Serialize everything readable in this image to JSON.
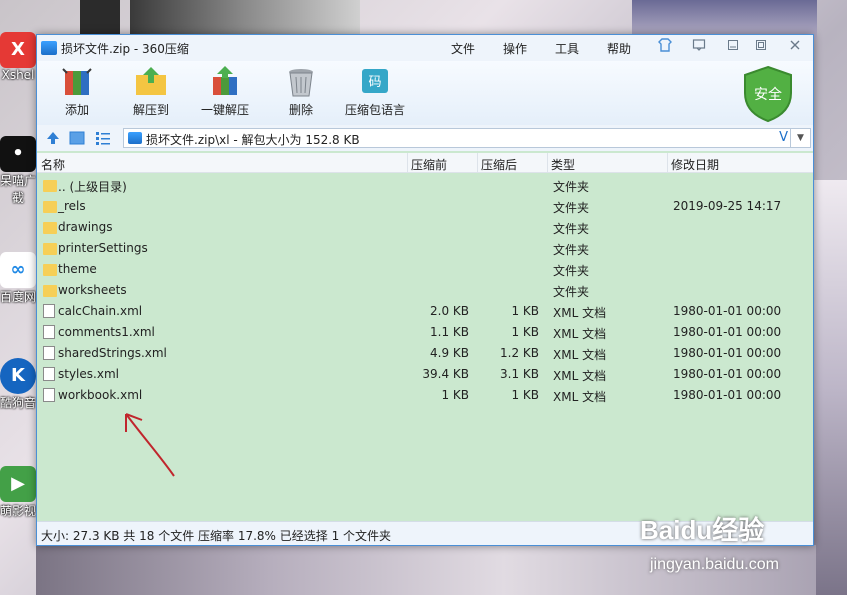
{
  "desktop": {
    "icons": [
      {
        "label": "Xshel",
        "color": "#e53935"
      },
      {
        "label": "呆喵广",
        "label2": "截",
        "color": "#111111"
      },
      {
        "label": "百度网",
        "color": "#1e88e5"
      },
      {
        "label": "酷狗音",
        "color": "#1565c0"
      },
      {
        "label": "萌影视",
        "color": "#43a047"
      }
    ]
  },
  "window": {
    "title": "损坏文件.zip - 360压缩",
    "menu": [
      "文件",
      "操作",
      "工具",
      "帮助"
    ]
  },
  "toolbar": {
    "buttons": [
      {
        "label": "添加",
        "icon": "add-books-icon"
      },
      {
        "label": "解压到",
        "icon": "extract-folder-icon"
      },
      {
        "label": "一键解压",
        "icon": "one-click-extract-icon"
      },
      {
        "label": "删除",
        "icon": "trash-icon"
      },
      {
        "label": "压缩包语言",
        "icon": "language-code-icon"
      }
    ],
    "safety_badge": "安全"
  },
  "address": {
    "path": "损坏文件.zip\\xl - 解包大小为 152.8 KB",
    "suffix": "V"
  },
  "table": {
    "columns": [
      "名称",
      "压缩前",
      "压缩后",
      "类型",
      "修改日期"
    ],
    "rows": [
      {
        "name": ".. (上级目录)",
        "packed": "",
        "orig": "",
        "type": "文件夹",
        "date": "",
        "icon": "folder"
      },
      {
        "name": "_rels",
        "packed": "",
        "orig": "",
        "type": "文件夹",
        "date": "2019-09-25 14:17",
        "icon": "folder"
      },
      {
        "name": "drawings",
        "packed": "",
        "orig": "",
        "type": "文件夹",
        "date": "",
        "icon": "folder"
      },
      {
        "name": "printerSettings",
        "packed": "",
        "orig": "",
        "type": "文件夹",
        "date": "",
        "icon": "folder"
      },
      {
        "name": "theme",
        "packed": "",
        "orig": "",
        "type": "文件夹",
        "date": "",
        "icon": "folder"
      },
      {
        "name": "worksheets",
        "packed": "",
        "orig": "",
        "type": "文件夹",
        "date": "",
        "icon": "folder"
      },
      {
        "name": "calcChain.xml",
        "packed": "2.0 KB",
        "orig": "1 KB",
        "type": "XML 文档",
        "date": "1980-01-01 00:00",
        "icon": "file"
      },
      {
        "name": "comments1.xml",
        "packed": "1.1 KB",
        "orig": "1 KB",
        "type": "XML 文档",
        "date": "1980-01-01 00:00",
        "icon": "file"
      },
      {
        "name": "sharedStrings.xml",
        "packed": "4.9 KB",
        "orig": "1.2 KB",
        "type": "XML 文档",
        "date": "1980-01-01 00:00",
        "icon": "file"
      },
      {
        "name": "styles.xml",
        "packed": "39.4 KB",
        "orig": "3.1 KB",
        "type": "XML 文档",
        "date": "1980-01-01 00:00",
        "icon": "file"
      },
      {
        "name": "workbook.xml",
        "packed": "1 KB",
        "orig": "1 KB",
        "type": "XML 文档",
        "date": "1980-01-01 00:00",
        "icon": "file"
      }
    ]
  },
  "status": "大小: 27.3 KB 共 18 个文件 压缩率 17.8% 已经选择 1 个文件夹",
  "watermark": {
    "logo": "Baidu经验",
    "url": "jingyan.baidu.com"
  },
  "colors": {
    "list_bg": "#cbe8cf",
    "accent": "#4a8fd6",
    "arrow": "#c0262d"
  }
}
